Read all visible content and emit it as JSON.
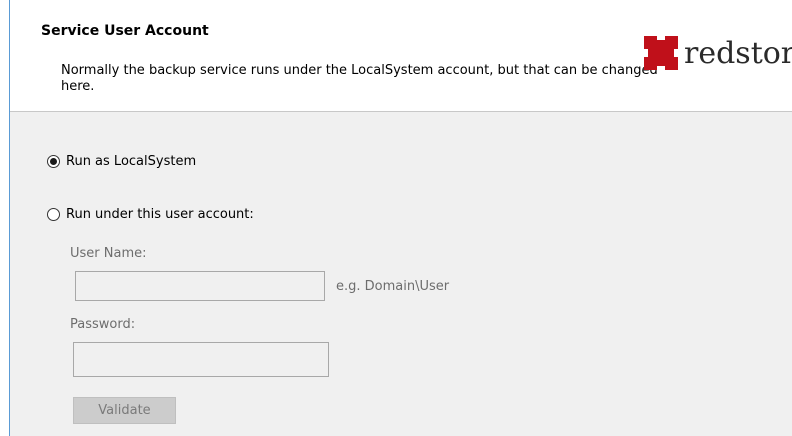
{
  "header": {
    "title": "Service User Account",
    "description": "Normally the backup service runs under the LocalSystem account, but that can be changed here."
  },
  "logo": {
    "text": "redstor",
    "brand_color": "#c0101a"
  },
  "options": {
    "run_as_localsystem": {
      "label": "Run as LocalSystem",
      "checked": true
    },
    "run_as_user": {
      "label": "Run under this user account:",
      "checked": false
    }
  },
  "form": {
    "username_label": "User Name:",
    "username_value": "",
    "username_hint": "e.g. Domain\\User",
    "password_label": "Password:",
    "password_value": "",
    "validate_label": "Validate"
  },
  "colors": {
    "panel_background": "#f0f0f0",
    "header_background": "#ffffff",
    "disabled_text": "#6d6d6d",
    "window_border": "#5a9bd5"
  }
}
